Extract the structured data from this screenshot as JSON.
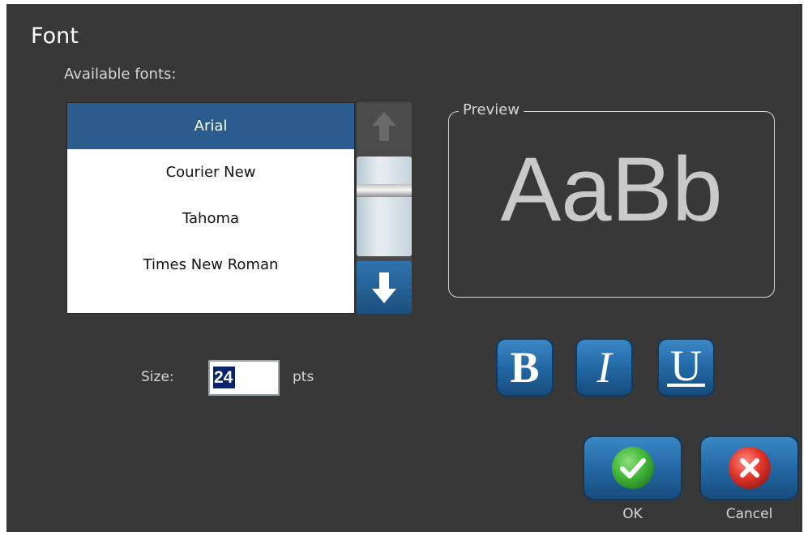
{
  "dialog": {
    "title": "Font",
    "available_fonts_label": "Available fonts:",
    "fonts": [
      {
        "name": "Arial",
        "selected": true
      },
      {
        "name": "Courier New",
        "selected": false
      },
      {
        "name": "Tahoma",
        "selected": false
      },
      {
        "name": "Times New Roman",
        "selected": false
      }
    ],
    "scroll": {
      "up_icon": "arrow-up-icon",
      "down_icon": "arrow-down-icon"
    },
    "preview": {
      "legend": "Preview",
      "sample_text": "AaBb"
    },
    "size": {
      "label": "Size:",
      "value": "24",
      "unit": "pts"
    },
    "style_buttons": {
      "bold": "B",
      "italic": "I",
      "underline": "U"
    },
    "actions": {
      "ok_label": "OK",
      "cancel_label": "Cancel",
      "ok_icon": "check-icon",
      "cancel_icon": "close-icon"
    }
  },
  "colors": {
    "background": "#383838",
    "selection": "#2a5d8e",
    "button_blue": "#2369a5",
    "ok_green": "#43b63a",
    "cancel_red": "#e0352b"
  }
}
